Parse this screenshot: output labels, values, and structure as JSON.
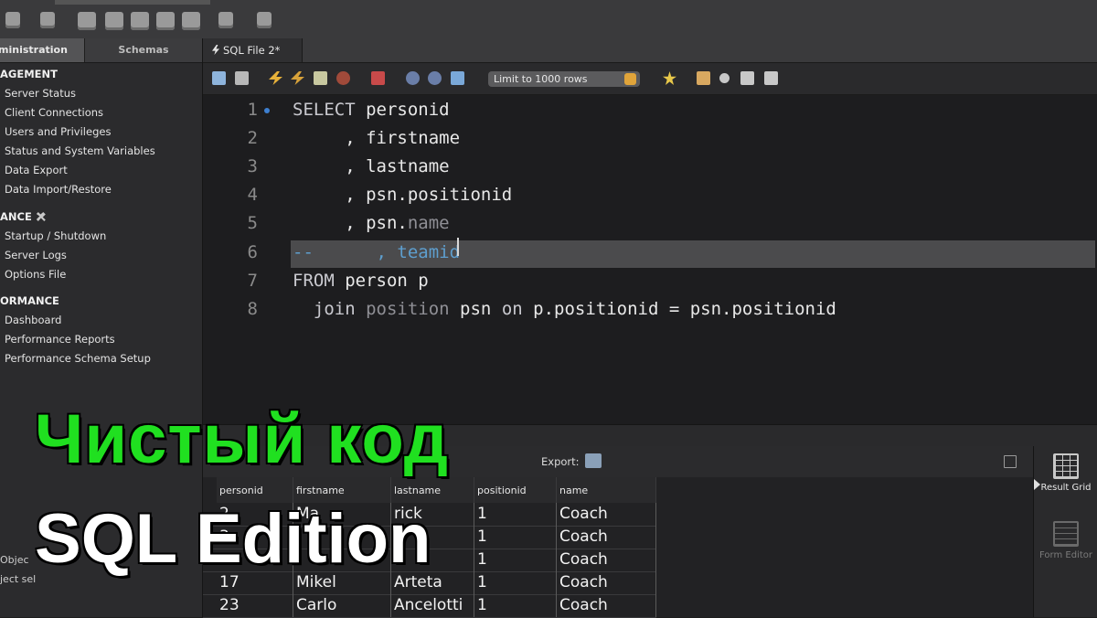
{
  "sidebar": {
    "tabs": [
      "ministration",
      "Schemas"
    ],
    "sections": [
      {
        "title": "AGEMENT",
        "items": [
          "Server Status",
          "Client Connections",
          "Users and Privileges",
          "Status and System Variables",
          "Data Export",
          "Data Import/Restore"
        ]
      },
      {
        "title": "ANCE",
        "items": [
          "Startup / Shutdown",
          "Server Logs",
          "Options File"
        ]
      },
      {
        "title": "ORMANCE",
        "items": [
          "Dashboard",
          "Performance Reports",
          "Performance Schema Setup"
        ]
      }
    ],
    "object_tab": "Objec",
    "object_sel": "ject sel"
  },
  "editor": {
    "tab_label": "SQL File 2*",
    "limit_label": "Limit to 1000 rows",
    "line_numbers": [
      "1",
      "2",
      "3",
      "4",
      "5",
      "6",
      "7",
      "8"
    ],
    "lines": [
      [
        "SELECT",
        " personid"
      ],
      [
        "     , firstname"
      ],
      [
        "     , lastname"
      ],
      [
        "     , psn.positionid"
      ],
      [
        "     , psn.",
        "name"
      ],
      [
        "--      , teamid"
      ],
      [
        "FROM",
        " person p"
      ],
      [
        "  ",
        "join",
        " position",
        " psn ",
        "on",
        " p.positionid = psn.positionid"
      ]
    ]
  },
  "results": {
    "export_label": "Export:",
    "columns": [
      "personid",
      "firstname",
      "lastname",
      "positionid",
      "name"
    ],
    "rows": [
      [
        "2",
        "Ma",
        "rick",
        "1",
        "Coach"
      ],
      [
        "3",
        "",
        "",
        "1",
        "Coach"
      ],
      [
        "1",
        "",
        "",
        "1",
        "Coach"
      ],
      [
        "17",
        "Mikel",
        "Arteta",
        "1",
        "Coach"
      ],
      [
        "23",
        "Carlo",
        "Ancelotti",
        "1",
        "Coach"
      ]
    ],
    "side_buttons": [
      "Result Grid",
      "Form Editor"
    ]
  },
  "overlay": {
    "line1": "Чистый код",
    "line2": "SQL Edition"
  },
  "colors": {
    "overlay_green": "#20e020",
    "comment_blue": "#5e9fcf",
    "limit_stepper": "#e0a43a"
  }
}
